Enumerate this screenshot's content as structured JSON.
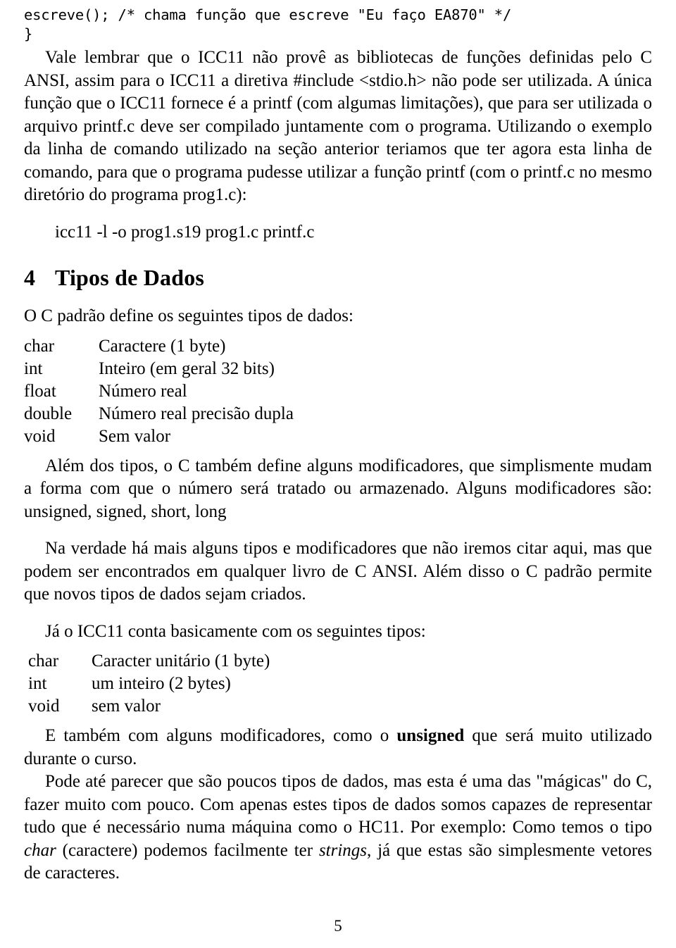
{
  "document": {
    "code_top": [
      "escreve(); /* chama função que escreve \"Eu faço EA870\" */",
      "}"
    ],
    "para1": "Vale lembrar que o ICC11 não provê as bibliotecas de funções definidas pelo C ANSI, assim para o ICC11 a diretiva #include <stdio.h> não pode ser utilizada. A única função que o ICC11 fornece é a printf (com algumas limitações), que para ser utilizada o arquivo printf.c deve ser compilado juntamente com o programa. Utilizando o exemplo da linha de comando utilizado na seção anterior teriamos que ter agora esta linha de comando, para que o programa pudesse utilizar a função printf (com o printf.c no mesmo diretório do programa prog1.c):",
    "command_line": "icc11 -l -o prog1.s19 prog1.c printf.c",
    "section": {
      "number": "4",
      "title": "Tipos de Dados"
    },
    "para2": "O C padrão define os seguintes tipos de dados:",
    "types_standard": [
      {
        "keyword": "char",
        "description": "Caractere (1 byte)"
      },
      {
        "keyword": "int",
        "description": "Inteiro (em geral 32 bits)"
      },
      {
        "keyword": "float",
        "description": "Número real"
      },
      {
        "keyword": "double",
        "description": "Número real precisão dupla"
      },
      {
        "keyword": "void",
        "description": "Sem valor"
      }
    ],
    "para3": "Além dos tipos, o C também define alguns modificadores, que simplismente mudam a forma com que o número será tratado ou armazenado. Alguns modificadores são: unsigned, signed, short, long",
    "para4": "Na verdade há mais alguns tipos e modificadores que não iremos citar aqui, mas que podem ser encontrados em qualquer livro de C ANSI. Além disso o C padrão permite que novos tipos de dados sejam criados.",
    "para5": "Já o ICC11 conta basicamente com os seguintes tipos:",
    "types_icc11": [
      {
        "keyword": "char",
        "description": "Caracter unitário (1 byte)"
      },
      {
        "keyword": "int",
        "description": "um inteiro (2 bytes)"
      },
      {
        "keyword": "void",
        "description": "sem valor"
      }
    ],
    "para6_pre": "E também com alguns modificadores, como o ",
    "para6_bold": "unsigned",
    "para6_post": " que será muito utilizado durante o curso.",
    "para7_a": "Pode até parecer que são poucos tipos de dados, mas esta é uma das \"mágicas\" do C, fazer muito com pouco. Com apenas estes tipos de dados somos capazes de representar tudo que é necessário numa máquina como o HC11. Por exemplo: Como temos o tipo ",
    "para7_ital1": "char",
    "para7_b": " (caractere) podemos facilmente ter ",
    "para7_ital2": "strings",
    "para7_c": ", já que estas são simplesmente vetores de caracteres.",
    "page_number": "5"
  }
}
